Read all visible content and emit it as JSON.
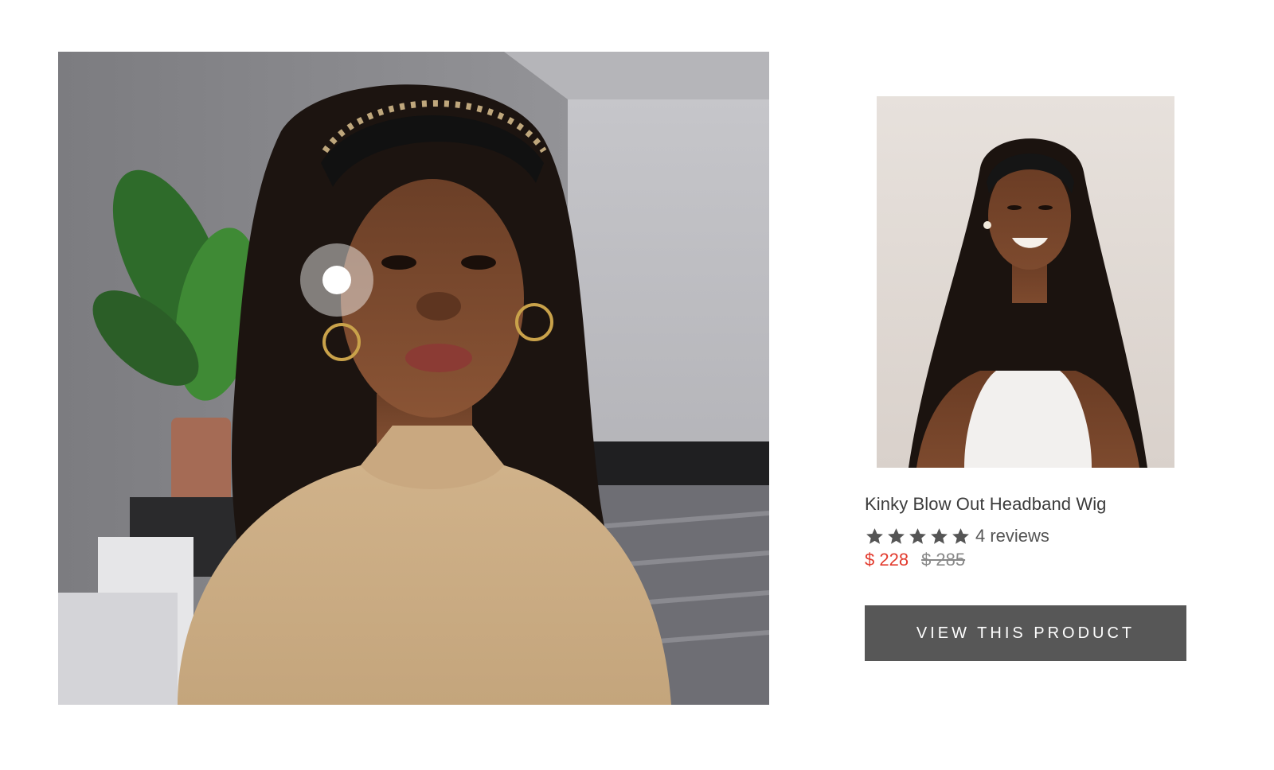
{
  "lifestyle": {
    "hotspot_label": ""
  },
  "product": {
    "title": "Kinky Blow Out Headband Wig",
    "rating_value": 5,
    "rating_max": 5,
    "reviews_label": "4 reviews",
    "price_sale": "$ 228",
    "price_compare": "$ 285",
    "button_label": "VIEW THIS PRODUCT"
  },
  "colors": {
    "sale_price": "#e23a2d",
    "button_bg": "#575757",
    "star": "#555555"
  },
  "icons": {
    "star": "star-icon",
    "hotspot": "hotspot-dot-icon"
  }
}
